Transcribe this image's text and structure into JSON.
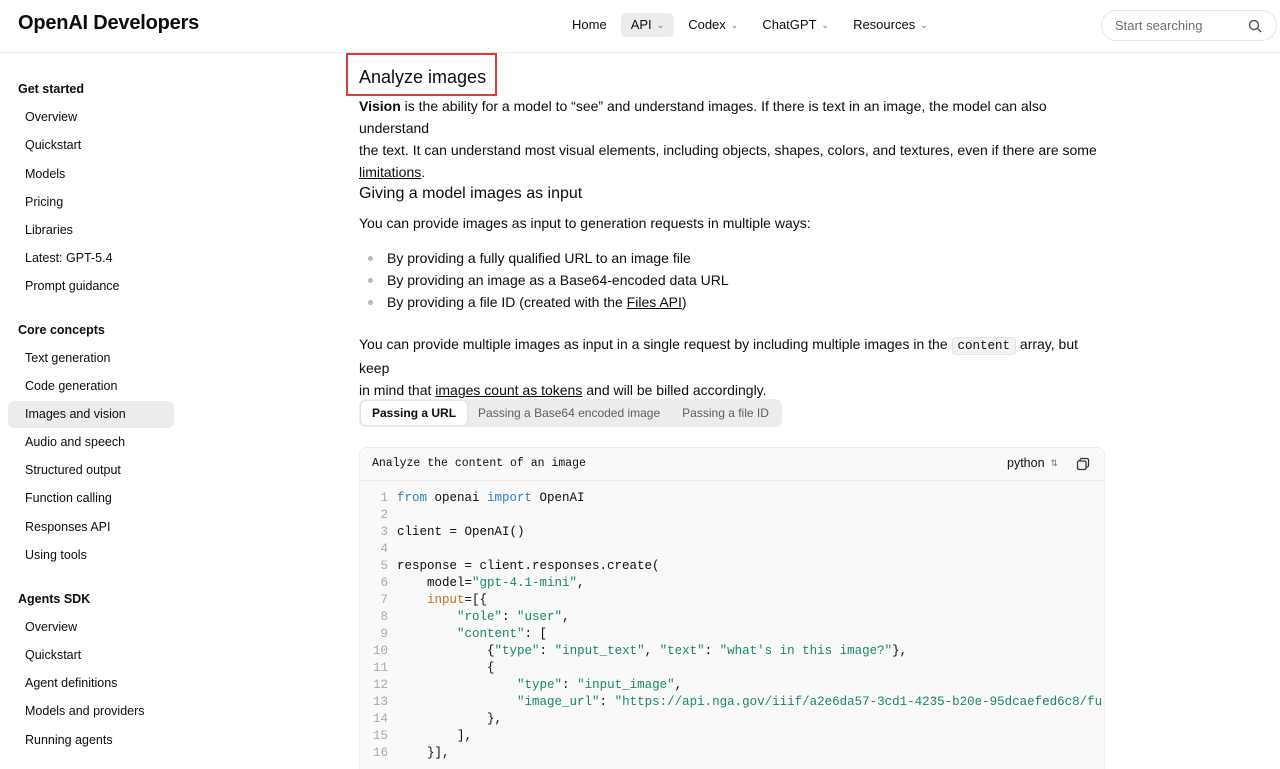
{
  "header": {
    "logo": "OpenAI Developers",
    "nav": [
      {
        "label": "Home",
        "dropdown": false,
        "active": false
      },
      {
        "label": "API",
        "dropdown": true,
        "active": true
      },
      {
        "label": "Codex",
        "dropdown": true,
        "active": false
      },
      {
        "label": "ChatGPT",
        "dropdown": true,
        "active": false
      },
      {
        "label": "Resources",
        "dropdown": true,
        "active": false
      }
    ],
    "search_placeholder": "Start searching"
  },
  "sidebar": {
    "sections": [
      {
        "title": "Get started",
        "items": [
          "Overview",
          "Quickstart",
          "Models",
          "Pricing",
          "Libraries",
          "Latest: GPT-5.4",
          "Prompt guidance"
        ]
      },
      {
        "title": "Core concepts",
        "items": [
          "Text generation",
          "Code generation",
          "Images and vision",
          "Audio and speech",
          "Structured output",
          "Function calling",
          "Responses API",
          "Using tools"
        ]
      },
      {
        "title": "Agents SDK",
        "items": [
          "Overview",
          "Quickstart",
          "Agent definitions",
          "Models and providers",
          "Running agents"
        ]
      }
    ],
    "active_item": "Images and vision"
  },
  "main": {
    "title": "Analyze images",
    "intro": {
      "bold": "Vision",
      "text1": " is the ability for a model to “see” and understand images. If there is text in an image, the model can also understand",
      "text2": "the text. It can understand most visual elements, including objects, shapes, colors, and textures, even if there are some",
      "link": "limitations",
      "end": "."
    },
    "subtitle": "Giving a model images as input",
    "ways_intro": "You can provide images as input to generation requests in multiple ways:",
    "bullets": [
      {
        "text": "By providing a fully qualified URL to an image file"
      },
      {
        "text": "By providing an image as a Base64-encoded data URL"
      },
      {
        "pre": "By providing a file ID (created with the ",
        "link": "Files API",
        "post": ")"
      }
    ],
    "multi": {
      "pre": "You can provide multiple images as input in a single request by including multiple images in the",
      "code": "content",
      "post": "array, but keep",
      "line2_pre": "in mind that",
      "link": "images count as tokens",
      "line2_post": "and will be billed accordingly."
    },
    "tabs": [
      "Passing a URL",
      "Passing a Base64 encoded image",
      "Passing a file ID"
    ],
    "active_tab": "Passing a URL",
    "code": {
      "title": "Analyze the content of an image",
      "language": "python",
      "line_numbers": [
        "1",
        "2",
        "3",
        "4",
        "5",
        "6",
        "7",
        "8",
        "9",
        "10",
        "11",
        "12",
        "13",
        "14",
        "15",
        "16"
      ]
    }
  },
  "colors": {
    "highlight": "#e0393e",
    "keyword": "#2d7fc0",
    "string": "#178a5c",
    "kwarg": "#c7741a"
  }
}
